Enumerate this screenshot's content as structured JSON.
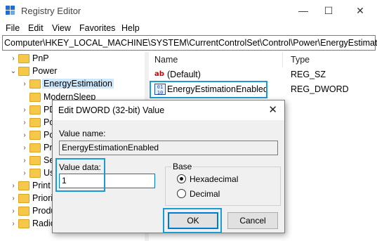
{
  "window": {
    "title": "Registry Editor",
    "controls": {
      "minimize": "—",
      "maximize": "☐",
      "close": "✕"
    }
  },
  "menu": [
    "File",
    "Edit",
    "View",
    "Favorites",
    "Help"
  ],
  "address": "Computer\\HKEY_LOCAL_MACHINE\\SYSTEM\\CurrentControlSet\\Control\\Power\\EnergyEstimation",
  "tree": {
    "items": [
      {
        "label": "PnP"
      },
      {
        "label": "Power"
      },
      {
        "label": "EnergyEstimation"
      },
      {
        "label": "ModernSleep"
      },
      {
        "label": "PD"
      },
      {
        "label": "Po"
      },
      {
        "label": "Po"
      },
      {
        "label": "Pr"
      },
      {
        "label": "Se"
      },
      {
        "label": "Us"
      },
      {
        "label": "Print"
      },
      {
        "label": "Priorit"
      },
      {
        "label": "Produ"
      },
      {
        "label": "Radio"
      }
    ]
  },
  "values_pane": {
    "columns": {
      "name": "Name",
      "type": "Type"
    },
    "rows": [
      {
        "name": "(Default)",
        "type": "REG_SZ",
        "icon": "string-value-icon"
      },
      {
        "name": "EnergyEstimationEnabled",
        "type": "REG_DWORD",
        "icon": "binary-value-icon"
      }
    ]
  },
  "dialog": {
    "title": "Edit DWORD (32-bit) Value",
    "close": "✕",
    "value_name_label": "Value name:",
    "value_name": "EnergyEstimationEnabled",
    "value_data_label": "Value data:",
    "value_data": "1",
    "base_label": "Base",
    "base_options": [
      "Hexadecimal",
      "Decimal"
    ],
    "base_selected": "Hexadecimal",
    "ok": "OK",
    "cancel": "Cancel"
  },
  "colors": {
    "highlight": "#1a9ad6",
    "folder": "#f5c84a",
    "selection": "#cce8ff"
  }
}
